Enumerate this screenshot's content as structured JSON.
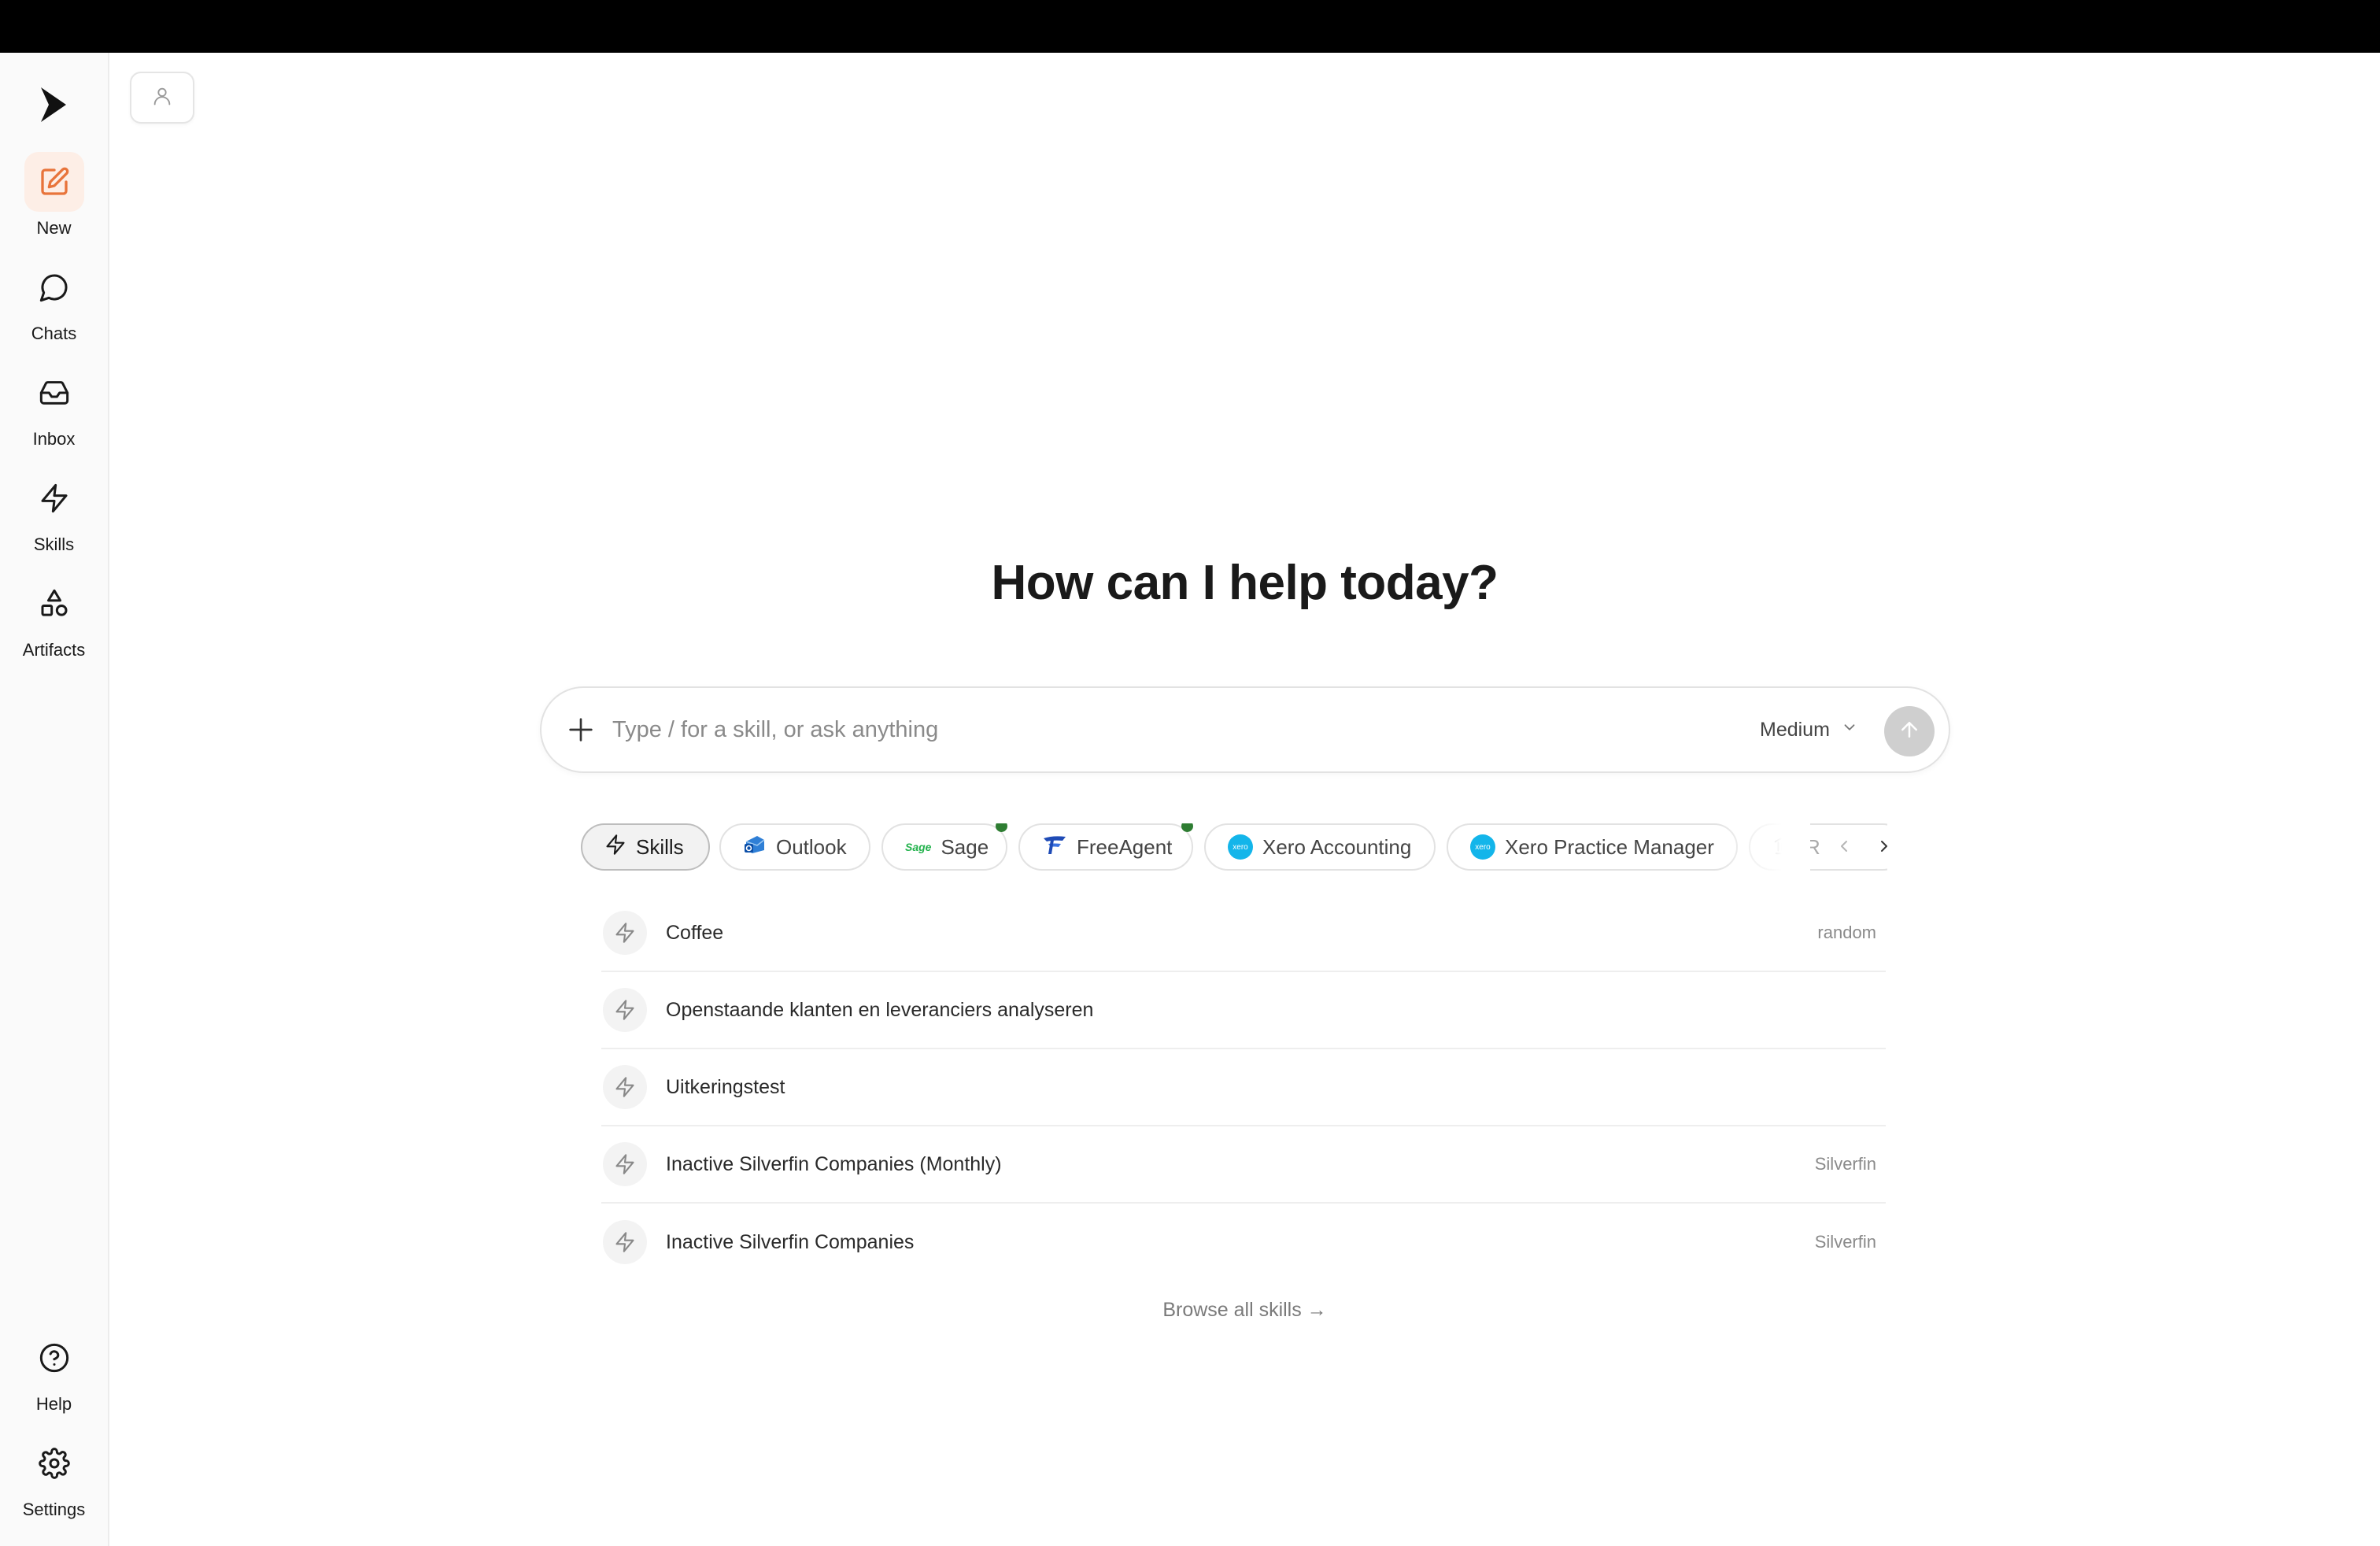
{
  "sidebar": {
    "items": [
      {
        "label": "New",
        "icon": "edit-icon"
      },
      {
        "label": "Chats",
        "icon": "chat-bubble-icon"
      },
      {
        "label": "Inbox",
        "icon": "inbox-icon"
      },
      {
        "label": "Skills",
        "icon": "lightning-icon"
      },
      {
        "label": "Artifacts",
        "icon": "shapes-icon"
      }
    ],
    "bottom_items": [
      {
        "label": "Help",
        "icon": "help-circle-icon"
      },
      {
        "label": "Settings",
        "icon": "gear-icon"
      }
    ]
  },
  "main": {
    "headline": "How can I help today?",
    "composer": {
      "placeholder": "Type / for a skill, or ask anything",
      "value": "",
      "model": "Medium"
    },
    "chips": [
      {
        "label": "Skills",
        "icon": "lightning-icon",
        "active": true
      },
      {
        "label": "Outlook",
        "icon": "outlook-icon"
      },
      {
        "label": "Sage",
        "icon": "sage-logo",
        "logo_text": "Sage",
        "connected": true
      },
      {
        "label": "FreeAgent",
        "icon": "freeagent-icon",
        "connected": true
      },
      {
        "label": "Xero Accounting",
        "icon": "xero-icon",
        "logo_text": "xero"
      },
      {
        "label": "Xero Practice Manager",
        "icon": "xero-icon",
        "logo_text": "xero"
      },
      {
        "label": "R",
        "icon": "bank-icon"
      }
    ],
    "skills": [
      {
        "name": "Coffee",
        "tag": "random"
      },
      {
        "name": "Openstaande klanten en leveranciers analyseren",
        "tag": ""
      },
      {
        "name": "Uitkeringstest",
        "tag": ""
      },
      {
        "name": "Inactive Silverfin Companies (Monthly)",
        "tag": "Silverfin"
      },
      {
        "name": "Inactive Silverfin Companies",
        "tag": "Silverfin"
      }
    ],
    "browse_label": "Browse all skills →"
  },
  "colors": {
    "accent": "#e8743b",
    "connected": "#2e7d32",
    "xero": "#13b5ea"
  }
}
